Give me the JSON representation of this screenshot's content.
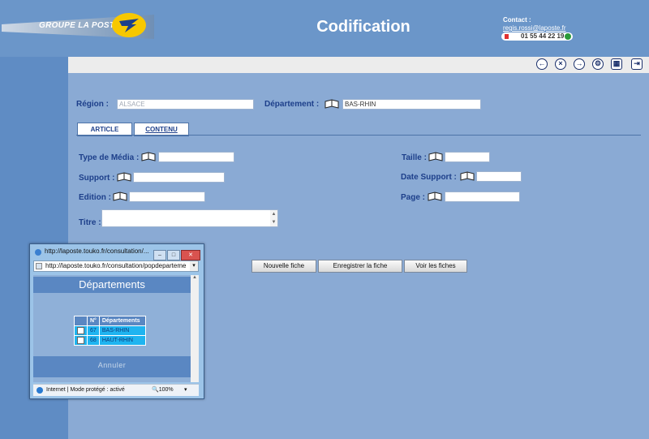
{
  "header": {
    "logo_text": "GROUPE LA POSTE",
    "title": "Codification",
    "contact_label": "Contact :",
    "contact_email": "regis.rossi@laposte.fr",
    "contact_phone": "01 55 44 22 19"
  },
  "toolbar": {
    "icons": [
      "back-icon",
      "close-circle-icon",
      "forward-icon",
      "settings-icon",
      "grid-icon",
      "export-icon"
    ]
  },
  "form": {
    "region_label": "Région :",
    "region_value": "ALSACE",
    "departement_label": "Département :",
    "departement_value": "BAS-RHIN",
    "tabs": [
      {
        "label": "ARTICLE",
        "active": true
      },
      {
        "label": "CONTENU",
        "active": false
      }
    ],
    "type_media_label": "Type de Média :",
    "support_label": "Support :",
    "edition_label": "Edition :",
    "titre_label": "Titre :",
    "taille_label": "Taille :",
    "date_support_label": "Date Support :",
    "page_label": "Page :"
  },
  "actions": {
    "nouvelle_fiche": "Nouvelle fiche",
    "enregistrer_fiche": "Enregistrer la fiche",
    "voir_fiches": "Voir les fiches"
  },
  "popup": {
    "window_title": "http://laposte.touko.fr/consultation/...",
    "address": "http://laposte.touko.fr/consultation/popdeparteme",
    "heading": "Départements",
    "table_headers": [
      "N°",
      "Départements"
    ],
    "rows": [
      {
        "num": "67",
        "name": "BAS-RHIN"
      },
      {
        "num": "68",
        "name": "HAUT-RHIN"
      }
    ],
    "annuler": "Annuler",
    "status_text": "Internet | Mode protégé : activé",
    "zoom": "100%"
  },
  "colors": {
    "background": "#8aaad4",
    "header": "#6b96c9",
    "label": "#1d3f8a",
    "table_row": "#1fb4f0"
  }
}
